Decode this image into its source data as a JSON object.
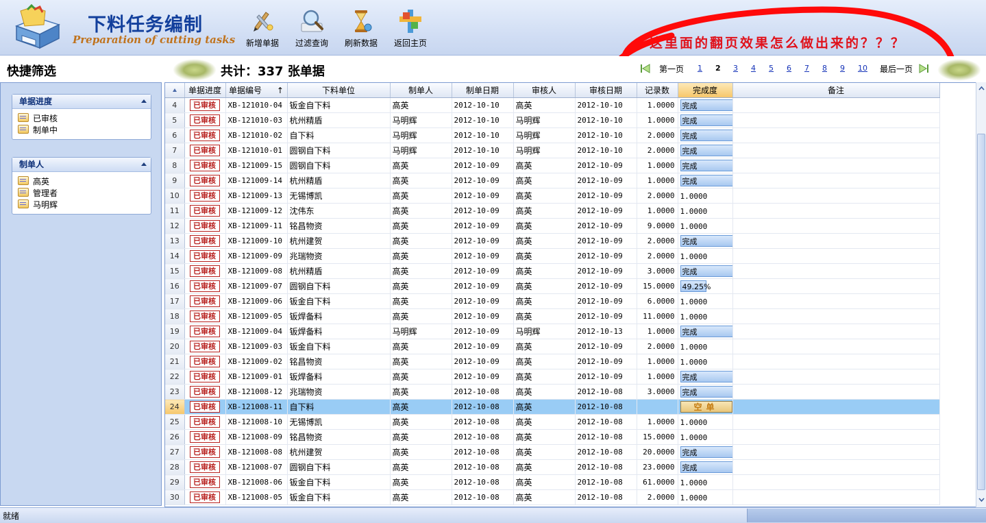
{
  "app": {
    "title_cn": "下料任务编制",
    "title_en": "Preparation of cutting tasks"
  },
  "toolbar": {
    "add_label": "新增单据",
    "filter_label": "过滤查询",
    "refresh_label": "刷新数据",
    "home_label": "返回主页"
  },
  "annotation": "这里面的翻页效果怎么做出来的？？？",
  "sidebar": {
    "title": "快捷筛选",
    "groups": [
      {
        "title": "单据进度",
        "items": [
          "已审核",
          "制单中"
        ]
      },
      {
        "title": "制单人",
        "items": [
          "高英",
          "管理者",
          "马明辉"
        ]
      }
    ]
  },
  "summary": {
    "total_text": "共计：337 张单据"
  },
  "pager": {
    "first_label": "第一页",
    "last_label": "最后一页",
    "pages": [
      "1",
      "2",
      "3",
      "4",
      "5",
      "6",
      "7",
      "8",
      "9",
      "10"
    ],
    "current": "2"
  },
  "table": {
    "columns": [
      "单据进度",
      "单据编号",
      "下料单位",
      "制单人",
      "制单日期",
      "审核人",
      "审核日期",
      "记录数",
      "完成度",
      "备注"
    ],
    "sort_indicator": "↑",
    "selected_row": "24",
    "rows": [
      {
        "n": "4",
        "status": "已审核",
        "code": "XB-121010-04",
        "unit": "钣金自下料",
        "maker": "高英",
        "date": "2012-10-10",
        "auditor": "高英",
        "adate": "2012-10-10",
        "count": "1.0000",
        "progress": "完成",
        "ptype": "box"
      },
      {
        "n": "5",
        "status": "已审核",
        "code": "XB-121010-03",
        "unit": "杭州精盾",
        "maker": "马明辉",
        "date": "2012-10-10",
        "auditor": "马明辉",
        "adate": "2012-10-10",
        "count": "1.0000",
        "progress": "完成",
        "ptype": "box"
      },
      {
        "n": "6",
        "status": "已审核",
        "code": "XB-121010-02",
        "unit": "自下料",
        "maker": "马明辉",
        "date": "2012-10-10",
        "auditor": "马明辉",
        "adate": "2012-10-10",
        "count": "2.0000",
        "progress": "完成",
        "ptype": "box"
      },
      {
        "n": "7",
        "status": "已审核",
        "code": "XB-121010-01",
        "unit": "圆钢自下料",
        "maker": "马明辉",
        "date": "2012-10-10",
        "auditor": "马明辉",
        "adate": "2012-10-10",
        "count": "2.0000",
        "progress": "完成",
        "ptype": "box"
      },
      {
        "n": "8",
        "status": "已审核",
        "code": "XB-121009-15",
        "unit": "圆钢自下料",
        "maker": "高英",
        "date": "2012-10-09",
        "auditor": "高英",
        "adate": "2012-10-09",
        "count": "1.0000",
        "progress": "完成",
        "ptype": "box"
      },
      {
        "n": "9",
        "status": "已审核",
        "code": "XB-121009-14",
        "unit": "杭州精盾",
        "maker": "高英",
        "date": "2012-10-09",
        "auditor": "高英",
        "adate": "2012-10-09",
        "count": "1.0000",
        "progress": "完成",
        "ptype": "box"
      },
      {
        "n": "10",
        "status": "已审核",
        "code": "XB-121009-13",
        "unit": "无锡博凯",
        "maker": "高英",
        "date": "2012-10-09",
        "auditor": "高英",
        "adate": "2012-10-09",
        "count": "2.0000",
        "progress": "1.0000",
        "ptype": "plain"
      },
      {
        "n": "11",
        "status": "已审核",
        "code": "XB-121009-12",
        "unit": "沈伟东",
        "maker": "高英",
        "date": "2012-10-09",
        "auditor": "高英",
        "adate": "2012-10-09",
        "count": "1.0000",
        "progress": "1.0000",
        "ptype": "plain"
      },
      {
        "n": "12",
        "status": "已审核",
        "code": "XB-121009-11",
        "unit": "铭昌物资",
        "maker": "高英",
        "date": "2012-10-09",
        "auditor": "高英",
        "adate": "2012-10-09",
        "count": "9.0000",
        "progress": "1.0000",
        "ptype": "plain"
      },
      {
        "n": "13",
        "status": "已审核",
        "code": "XB-121009-10",
        "unit": "杭州建贺",
        "maker": "高英",
        "date": "2012-10-09",
        "auditor": "高英",
        "adate": "2012-10-09",
        "count": "2.0000",
        "progress": "完成",
        "ptype": "box"
      },
      {
        "n": "14",
        "status": "已审核",
        "code": "XB-121009-09",
        "unit": "兆瑞物资",
        "maker": "高英",
        "date": "2012-10-09",
        "auditor": "高英",
        "adate": "2012-10-09",
        "count": "2.0000",
        "progress": "1.0000",
        "ptype": "plain"
      },
      {
        "n": "15",
        "status": "已审核",
        "code": "XB-121009-08",
        "unit": "杭州精盾",
        "maker": "高英",
        "date": "2012-10-09",
        "auditor": "高英",
        "adate": "2012-10-09",
        "count": "3.0000",
        "progress": "完成",
        "ptype": "box"
      },
      {
        "n": "16",
        "status": "已审核",
        "code": "XB-121009-07",
        "unit": "圆钢自下料",
        "maker": "高英",
        "date": "2012-10-09",
        "auditor": "高英",
        "adate": "2012-10-09",
        "count": "15.0000",
        "progress": "49.25%",
        "ptype": "partial",
        "fraction": 0.4925
      },
      {
        "n": "17",
        "status": "已审核",
        "code": "XB-121009-06",
        "unit": "钣金自下料",
        "maker": "高英",
        "date": "2012-10-09",
        "auditor": "高英",
        "adate": "2012-10-09",
        "count": "6.0000",
        "progress": "1.0000",
        "ptype": "plain"
      },
      {
        "n": "18",
        "status": "已审核",
        "code": "XB-121009-05",
        "unit": "钣焊备料",
        "maker": "高英",
        "date": "2012-10-09",
        "auditor": "高英",
        "adate": "2012-10-09",
        "count": "11.0000",
        "progress": "1.0000",
        "ptype": "plain"
      },
      {
        "n": "19",
        "status": "已审核",
        "code": "XB-121009-04",
        "unit": "钣焊备料",
        "maker": "马明辉",
        "date": "2012-10-09",
        "auditor": "马明辉",
        "adate": "2012-10-13",
        "count": "1.0000",
        "progress": "完成",
        "ptype": "box"
      },
      {
        "n": "20",
        "status": "已审核",
        "code": "XB-121009-03",
        "unit": "钣金自下料",
        "maker": "高英",
        "date": "2012-10-09",
        "auditor": "高英",
        "adate": "2012-10-09",
        "count": "2.0000",
        "progress": "1.0000",
        "ptype": "plain"
      },
      {
        "n": "21",
        "status": "已审核",
        "code": "XB-121009-02",
        "unit": "铭昌物资",
        "maker": "高英",
        "date": "2012-10-09",
        "auditor": "高英",
        "adate": "2012-10-09",
        "count": "1.0000",
        "progress": "1.0000",
        "ptype": "plain"
      },
      {
        "n": "22",
        "status": "已审核",
        "code": "XB-121009-01",
        "unit": "钣焊备料",
        "maker": "高英",
        "date": "2012-10-09",
        "auditor": "高英",
        "adate": "2012-10-09",
        "count": "1.0000",
        "progress": "完成",
        "ptype": "box"
      },
      {
        "n": "23",
        "status": "已审核",
        "code": "XB-121008-12",
        "unit": "兆瑞物资",
        "maker": "高英",
        "date": "2012-10-08",
        "auditor": "高英",
        "adate": "2012-10-08",
        "count": "3.0000",
        "progress": "完成",
        "ptype": "box"
      },
      {
        "n": "24",
        "status": "已审核",
        "code": "XB-121008-11",
        "unit": "自下料",
        "maker": "高英",
        "date": "2012-10-08",
        "auditor": "高英",
        "adate": "2012-10-08",
        "count": "",
        "progress": "空单",
        "ptype": "empty"
      },
      {
        "n": "25",
        "status": "已审核",
        "code": "XB-121008-10",
        "unit": "无锡博凯",
        "maker": "高英",
        "date": "2012-10-08",
        "auditor": "高英",
        "adate": "2012-10-08",
        "count": "1.0000",
        "progress": "1.0000",
        "ptype": "plain"
      },
      {
        "n": "26",
        "status": "已审核",
        "code": "XB-121008-09",
        "unit": "铭昌物资",
        "maker": "高英",
        "date": "2012-10-08",
        "auditor": "高英",
        "adate": "2012-10-08",
        "count": "15.0000",
        "progress": "1.0000",
        "ptype": "plain"
      },
      {
        "n": "27",
        "status": "已审核",
        "code": "XB-121008-08",
        "unit": "杭州建贺",
        "maker": "高英",
        "date": "2012-10-08",
        "auditor": "高英",
        "adate": "2012-10-08",
        "count": "20.0000",
        "progress": "完成",
        "ptype": "box"
      },
      {
        "n": "28",
        "status": "已审核",
        "code": "XB-121008-07",
        "unit": "圆钢自下料",
        "maker": "高英",
        "date": "2012-10-08",
        "auditor": "高英",
        "adate": "2012-10-08",
        "count": "23.0000",
        "progress": "完成",
        "ptype": "box"
      },
      {
        "n": "29",
        "status": "已审核",
        "code": "XB-121008-06",
        "unit": "钣金自下料",
        "maker": "高英",
        "date": "2012-10-08",
        "auditor": "高英",
        "adate": "2012-10-08",
        "count": "61.0000",
        "progress": "1.0000",
        "ptype": "plain"
      },
      {
        "n": "30",
        "status": "已审核",
        "code": "XB-121008-05",
        "unit": "钣金自下料",
        "maker": "高英",
        "date": "2012-10-08",
        "auditor": "高英",
        "adate": "2012-10-08",
        "count": "2.0000",
        "progress": "1.0000",
        "ptype": "plain"
      }
    ]
  },
  "status": {
    "text": "就绪"
  },
  "colors": {
    "header_title": "#123f9c",
    "header_subtitle": "#c0731d",
    "annotation": "#e0121b",
    "stamp": "#b8201e",
    "selection": "#99ccf5",
    "link": "#1533b8"
  },
  "icons": {
    "logo": "save-box-logo-icon",
    "add": "add-document-icon",
    "filter": "magnifier-icon",
    "refresh": "hourglass-icon",
    "home": "home-puzzle-icon",
    "pager_first": "first-page-icon",
    "pager_last": "last-page-icon"
  }
}
